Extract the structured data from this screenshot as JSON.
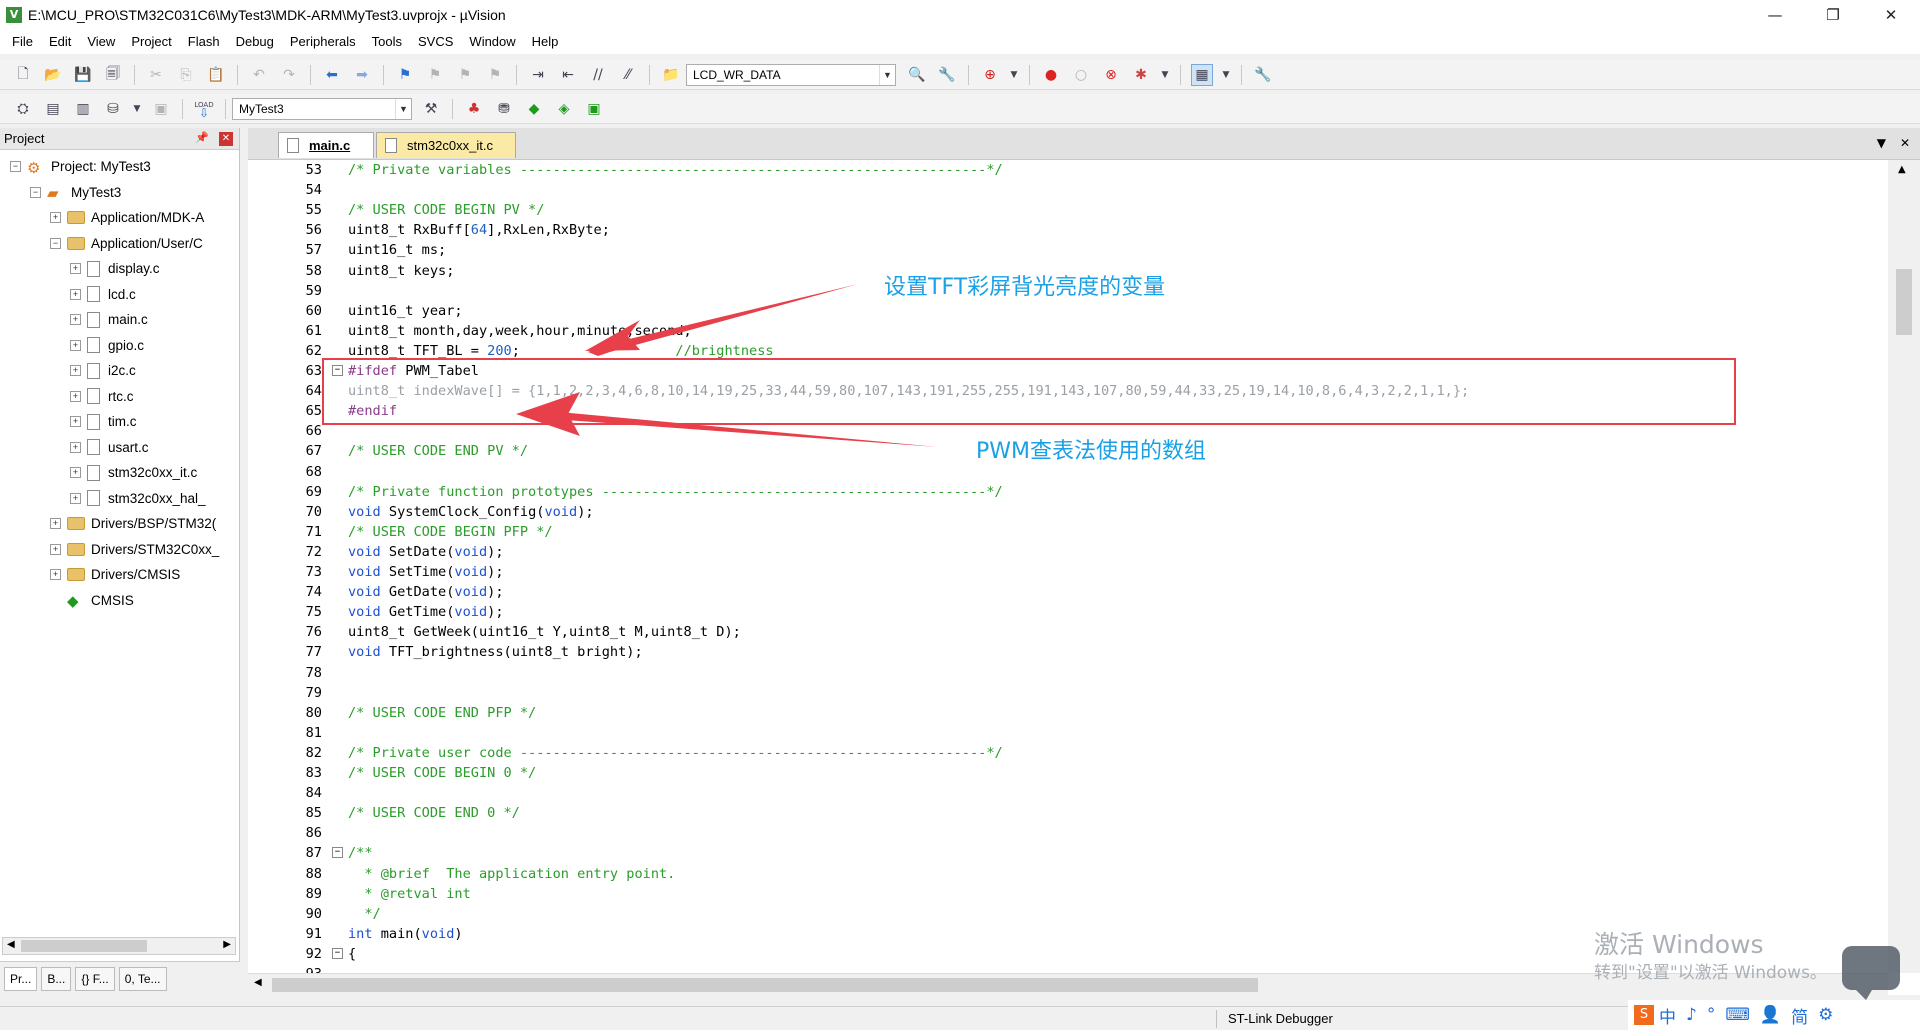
{
  "window": {
    "title": "E:\\MCU_PRO\\STM32C031C6\\MyTest3\\MDK-ARM\\MyTest3.uvprojx - µVision",
    "app_icon": "V",
    "controls": [
      "—",
      "❐",
      "✕"
    ]
  },
  "menu": [
    "File",
    "Edit",
    "View",
    "Project",
    "Flash",
    "Debug",
    "Peripherals",
    "Tools",
    "SVCS",
    "Window",
    "Help"
  ],
  "toolbar1": {
    "find_combo": "LCD_WR_DATA"
  },
  "toolbar2": {
    "target_combo": "MyTest3",
    "load_label": "LOAD"
  },
  "project_panel": {
    "title": "Project",
    "pin": "📌",
    "close": "✕",
    "tree": [
      {
        "label": "Project: MyTest3",
        "level": 0,
        "expander": "−",
        "icon": "project-icon"
      },
      {
        "label": "MyTest3",
        "level": 1,
        "expander": "−",
        "icon": "target-icon"
      },
      {
        "label": "Application/MDK-A",
        "level": 2,
        "expander": "+",
        "icon": "folder-icon"
      },
      {
        "label": "Application/User/C",
        "level": 2,
        "expander": "−",
        "icon": "folder-icon"
      },
      {
        "label": "display.c",
        "level": 3,
        "expander": "+",
        "icon": "file-icon"
      },
      {
        "label": "lcd.c",
        "level": 3,
        "expander": "+",
        "icon": "file-icon"
      },
      {
        "label": "main.c",
        "level": 3,
        "expander": "+",
        "icon": "file-icon"
      },
      {
        "label": "gpio.c",
        "level": 3,
        "expander": "+",
        "icon": "file-icon"
      },
      {
        "label": "i2c.c",
        "level": 3,
        "expander": "+",
        "icon": "file-icon"
      },
      {
        "label": "rtc.c",
        "level": 3,
        "expander": "+",
        "icon": "file-icon"
      },
      {
        "label": "tim.c",
        "level": 3,
        "expander": "+",
        "icon": "file-icon"
      },
      {
        "label": "usart.c",
        "level": 3,
        "expander": "+",
        "icon": "file-icon"
      },
      {
        "label": "stm32c0xx_it.c",
        "level": 3,
        "expander": "+",
        "icon": "file-icon"
      },
      {
        "label": "stm32c0xx_hal_",
        "level": 3,
        "expander": "+",
        "icon": "file-icon"
      },
      {
        "label": "Drivers/BSP/STM32(",
        "level": 2,
        "expander": "+",
        "icon": "folder-icon"
      },
      {
        "label": "Drivers/STM32C0xx_",
        "level": 2,
        "expander": "+",
        "icon": "folder-icon"
      },
      {
        "label": "Drivers/CMSIS",
        "level": 2,
        "expander": "+",
        "icon": "folder-icon"
      },
      {
        "label": "CMSIS",
        "level": 2,
        "expander": "",
        "icon": "cmsis-icon"
      }
    ],
    "tabs": [
      "Pr...",
      "B...",
      "{} F...",
      "0, Te..."
    ]
  },
  "editor": {
    "tabs": [
      {
        "label": "main.c",
        "active": true
      },
      {
        "label": "stm32c0xx_it.c",
        "active": false
      }
    ],
    "lines": [
      {
        "n": "53",
        "fold": "",
        "parts": [
          [
            "c",
            "/* Private variables ---------------------------------------------------------*/"
          ]
        ]
      },
      {
        "n": "54",
        "fold": "",
        "parts": []
      },
      {
        "n": "55",
        "fold": "",
        "parts": [
          [
            "c",
            "/* USER CODE BEGIN PV */"
          ]
        ]
      },
      {
        "n": "56",
        "fold": "",
        "parts": [
          [
            "t",
            "uint8_t RxBuff["
          ],
          [
            "n",
            "64"
          ],
          [
            "t",
            "],RxLen,RxByte;"
          ]
        ]
      },
      {
        "n": "57",
        "fold": "",
        "parts": [
          [
            "t",
            "uint16_t ms;"
          ]
        ]
      },
      {
        "n": "58",
        "fold": "",
        "parts": [
          [
            "t",
            "uint8_t keys;"
          ]
        ]
      },
      {
        "n": "59",
        "fold": "",
        "parts": []
      },
      {
        "n": "60",
        "fold": "",
        "parts": [
          [
            "t",
            "uint16_t year;"
          ]
        ]
      },
      {
        "n": "61",
        "fold": "",
        "parts": [
          [
            "t",
            "uint8_t month,day,week,hour,minute,second;"
          ]
        ]
      },
      {
        "n": "62",
        "fold": "",
        "parts": [
          [
            "t",
            "uint8_t TFT_BL = "
          ],
          [
            "n",
            "200"
          ],
          [
            "t",
            ";                   "
          ],
          [
            "c",
            "//brightness"
          ]
        ]
      },
      {
        "n": "63",
        "fold": "−",
        "parts": [
          [
            "p",
            "#ifdef"
          ],
          [
            "t",
            " PWM_Tabel"
          ]
        ]
      },
      {
        "n": "64",
        "fold": "",
        "parts": [
          [
            "g",
            "uint8_t indexWave[] = {1,1,2,2,3,4,6,8,10,14,19,25,33,44,59,80,107,143,191,255,255,191,143,107,80,59,44,33,25,19,14,10,8,6,4,3,2,2,1,1,};"
          ]
        ]
      },
      {
        "n": "65",
        "fold": "",
        "parts": [
          [
            "p",
            "#endif"
          ]
        ]
      },
      {
        "n": "66",
        "fold": "",
        "parts": []
      },
      {
        "n": "67",
        "fold": "",
        "parts": [
          [
            "c",
            "/* USER CODE END PV */"
          ]
        ]
      },
      {
        "n": "68",
        "fold": "",
        "parts": []
      },
      {
        "n": "69",
        "fold": "",
        "parts": [
          [
            "c",
            "/* Private function prototypes -----------------------------------------------*/"
          ]
        ]
      },
      {
        "n": "70",
        "fold": "",
        "parts": [
          [
            "k",
            "void"
          ],
          [
            "t",
            " SystemClock_Config("
          ],
          [
            "k",
            "void"
          ],
          [
            "t",
            ");"
          ]
        ]
      },
      {
        "n": "71",
        "fold": "",
        "parts": [
          [
            "c",
            "/* USER CODE BEGIN PFP */"
          ]
        ]
      },
      {
        "n": "72",
        "fold": "",
        "parts": [
          [
            "k",
            "void"
          ],
          [
            "t",
            " SetDate("
          ],
          [
            "k",
            "void"
          ],
          [
            "t",
            ");"
          ]
        ]
      },
      {
        "n": "73",
        "fold": "",
        "parts": [
          [
            "k",
            "void"
          ],
          [
            "t",
            " SetTime("
          ],
          [
            "k",
            "void"
          ],
          [
            "t",
            ");"
          ]
        ]
      },
      {
        "n": "74",
        "fold": "",
        "parts": [
          [
            "k",
            "void"
          ],
          [
            "t",
            " GetDate("
          ],
          [
            "k",
            "void"
          ],
          [
            "t",
            ");"
          ]
        ]
      },
      {
        "n": "75",
        "fold": "",
        "parts": [
          [
            "k",
            "void"
          ],
          [
            "t",
            " GetTime("
          ],
          [
            "k",
            "void"
          ],
          [
            "t",
            ");"
          ]
        ]
      },
      {
        "n": "76",
        "fold": "",
        "parts": [
          [
            "t",
            "uint8_t GetWeek(uint16_t Y,uint8_t M,uint8_t D);"
          ]
        ]
      },
      {
        "n": "77",
        "fold": "",
        "parts": [
          [
            "k",
            "void"
          ],
          [
            "t",
            " TFT_brightness(uint8_t bright);"
          ]
        ]
      },
      {
        "n": "78",
        "fold": "",
        "parts": []
      },
      {
        "n": "79",
        "fold": "",
        "parts": []
      },
      {
        "n": "80",
        "fold": "",
        "parts": [
          [
            "c",
            "/* USER CODE END PFP */"
          ]
        ]
      },
      {
        "n": "81",
        "fold": "",
        "parts": []
      },
      {
        "n": "82",
        "fold": "",
        "parts": [
          [
            "c",
            "/* Private user code ---------------------------------------------------------*/"
          ]
        ]
      },
      {
        "n": "83",
        "fold": "",
        "parts": [
          [
            "c",
            "/* USER CODE BEGIN 0 */"
          ]
        ]
      },
      {
        "n": "84",
        "fold": "",
        "parts": []
      },
      {
        "n": "85",
        "fold": "",
        "parts": [
          [
            "c",
            "/* USER CODE END 0 */"
          ]
        ]
      },
      {
        "n": "86",
        "fold": "",
        "parts": []
      },
      {
        "n": "87",
        "fold": "−",
        "parts": [
          [
            "c",
            "/**"
          ]
        ]
      },
      {
        "n": "88",
        "fold": "",
        "parts": [
          [
            "c",
            "  * @brief  The application entry point."
          ]
        ]
      },
      {
        "n": "89",
        "fold": "",
        "parts": [
          [
            "c",
            "  * @retval int"
          ]
        ]
      },
      {
        "n": "90",
        "fold": "",
        "parts": [
          [
            "c",
            "  */"
          ]
        ]
      },
      {
        "n": "91",
        "fold": "",
        "parts": [
          [
            "k",
            "int"
          ],
          [
            "t",
            " main("
          ],
          [
            "k",
            "void"
          ],
          [
            "t",
            ")"
          ]
        ]
      },
      {
        "n": "92",
        "fold": "−",
        "parts": [
          [
            "t",
            "{"
          ]
        ]
      },
      {
        "n": "93",
        "fold": "",
        "parts": []
      }
    ]
  },
  "annotations": {
    "top_label": "设置TFT彩屏背光亮度的变量",
    "bottom_label": "PWM查表法使用的数组",
    "color": "#e8404a",
    "text_color": "#1aa0e6"
  },
  "statusbar": {
    "debugger": "ST-Link Debugger"
  },
  "watermark": {
    "line1": "激活 Windows",
    "line2": "转到\"设置\"以激活 Windows。"
  },
  "ime": [
    "中",
    "♪",
    "°",
    "⌨",
    "👤",
    "简",
    "⚙"
  ]
}
